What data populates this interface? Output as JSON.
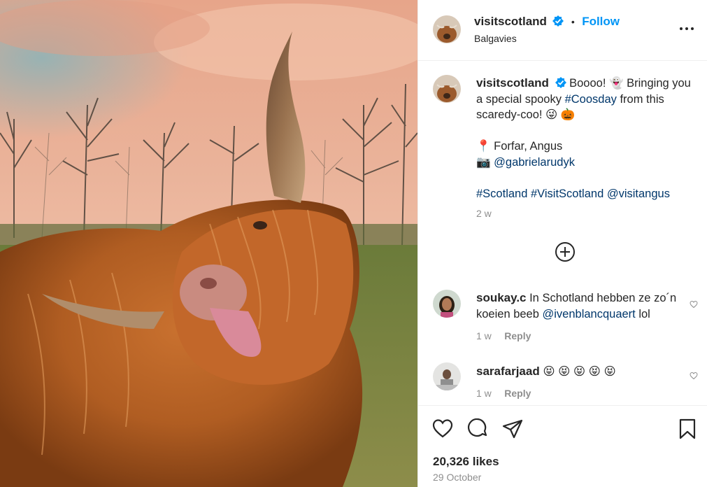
{
  "post": {
    "image_alt": "Highland cow with a horn pointing up, sticking its tongue out, trees behind under a pink sky"
  },
  "header": {
    "username": "visitscotland",
    "follow_label": "Follow",
    "location": "Balgavies",
    "more_icon": "more-horizontal-icon"
  },
  "caption": {
    "username": "visitscotland",
    "text_1": "Boooo!",
    "emoji_ghost": "👻",
    "text_2": " Bringing you a special spooky ",
    "hashtag_coosday": "#Coosday",
    "text_3": " from this scaredy-coo! ",
    "emoji_tongue": "😜",
    "emoji_pumpkin": "🎃",
    "pin_emoji": "📍",
    "location": "Forfar, Angus",
    "camera_emoji": "📷",
    "photographer": "@gabrielarudyk",
    "tag_scotland": "#Scotland",
    "tag_visitscotland": "#VisitScotland",
    "mention_visitangus": "@visitangus",
    "time": "2 w"
  },
  "comments": [
    {
      "username": "soukay.c",
      "text_1": " In Schotland hebben ze zo´n koeien beeb ",
      "mention": "@ivenblancquaert",
      "text_2": " lol",
      "time": "1 w",
      "reply_label": "Reply"
    },
    {
      "username": "sarafarjaad",
      "emojis": "😝 😝 😝 😝 😝",
      "time": "1 w",
      "reply_label": "Reply"
    }
  ],
  "actions": {
    "likes": "20,326 likes",
    "date": "29 October"
  },
  "colors": {
    "accent": "#0095f6",
    "link": "#00376b",
    "muted": "#8e8e8e",
    "text": "#262626"
  }
}
